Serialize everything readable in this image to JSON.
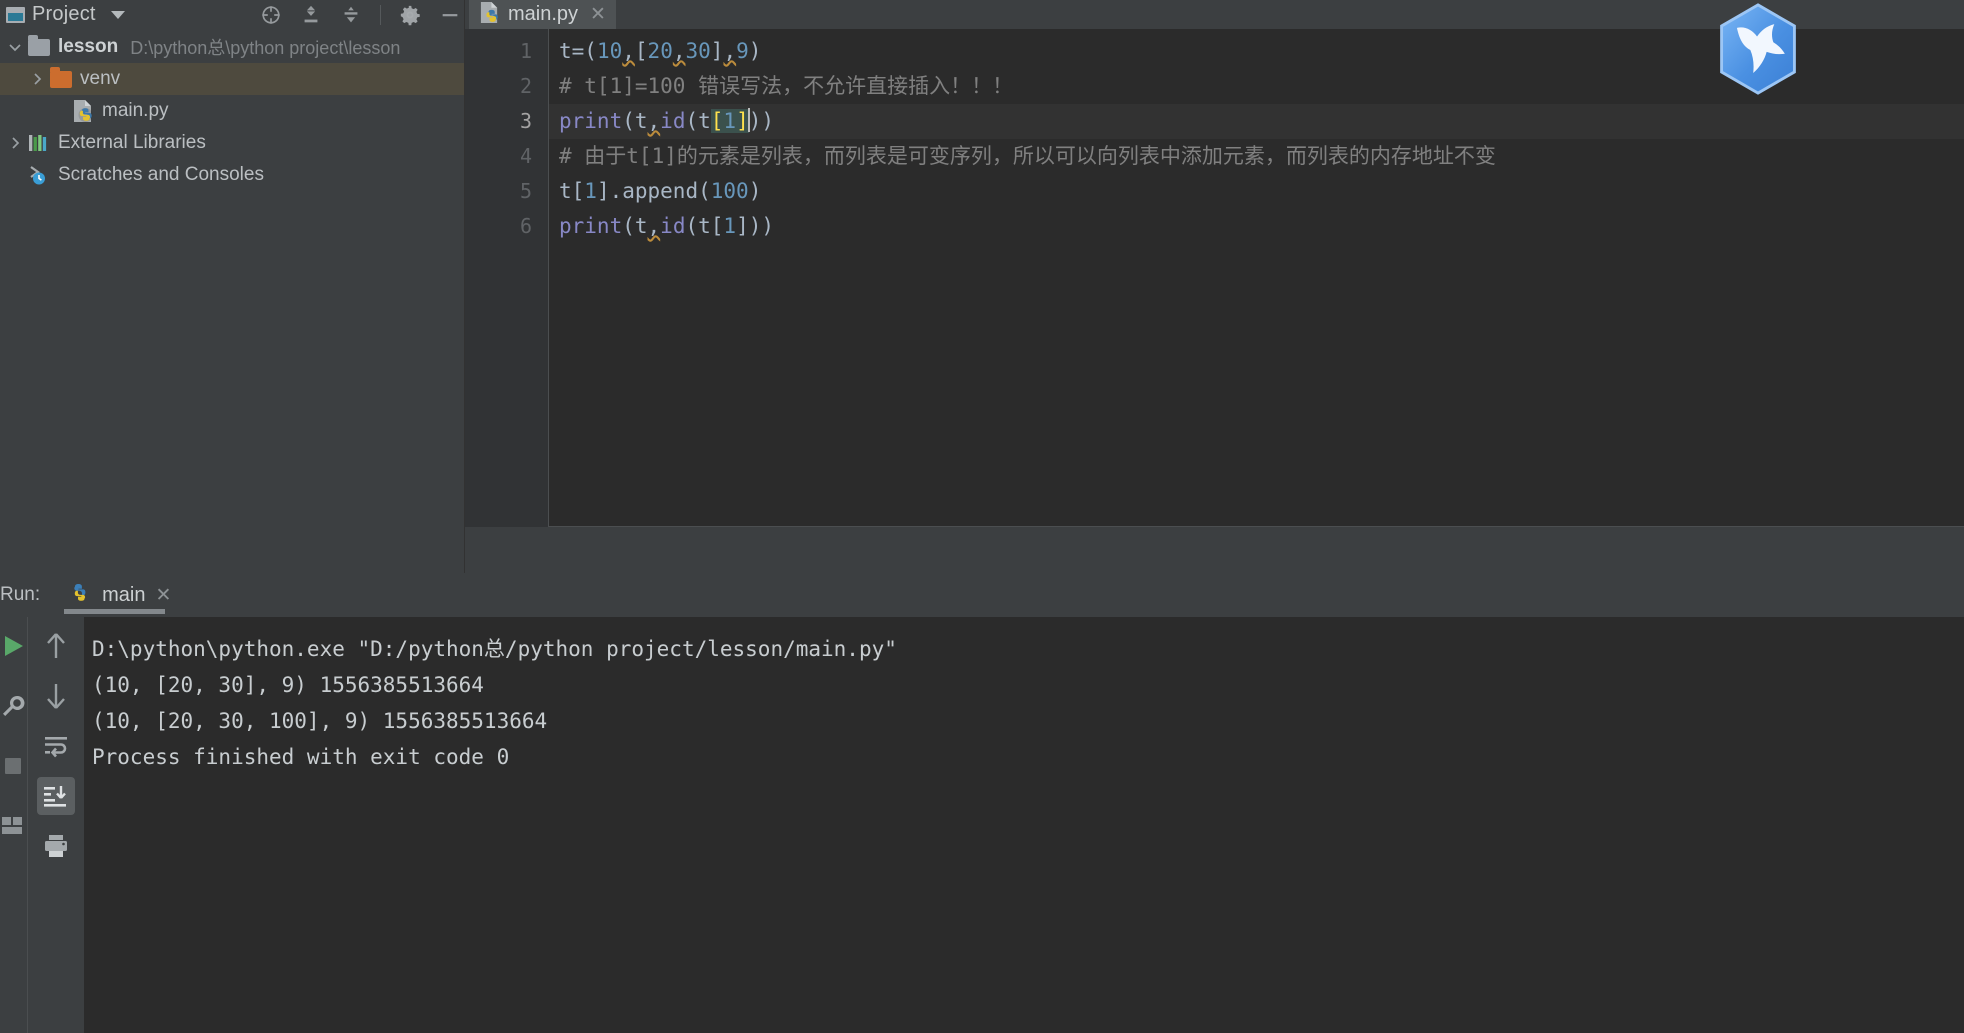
{
  "project_panel": {
    "title": "Project",
    "window_icon": "project-window-icon",
    "dropdown_icon": "chevron-down-icon",
    "toolbar": [
      {
        "name": "locate-icon",
        "tooltip": "Select Opened File"
      },
      {
        "name": "expand-all-icon",
        "tooltip": "Expand All"
      },
      {
        "name": "collapse-all-icon",
        "tooltip": "Collapse All"
      },
      {
        "name": "gear-icon",
        "tooltip": "Settings"
      },
      {
        "name": "minimize-icon",
        "tooltip": "Hide"
      }
    ],
    "tree": [
      {
        "label": "lesson",
        "path": "D:\\python总\\python project\\lesson",
        "icon": "folder-grey-icon",
        "arrow": "expanded",
        "bold": true,
        "selected": false,
        "indent": 0
      },
      {
        "label": "venv",
        "path": "",
        "icon": "folder-orange-icon",
        "arrow": "collapsed",
        "bold": false,
        "selected": true,
        "indent": 1
      },
      {
        "label": "main.py",
        "path": "",
        "icon": "python-file-icon",
        "arrow": "none",
        "bold": false,
        "selected": false,
        "indent": 2
      },
      {
        "label": "External Libraries",
        "path": "",
        "icon": "libraries-icon",
        "arrow": "collapsed",
        "bold": false,
        "selected": false,
        "indent": 0
      },
      {
        "label": "Scratches and Consoles",
        "path": "",
        "icon": "scratches-icon",
        "arrow": "none",
        "bold": false,
        "selected": false,
        "indent": 0
      }
    ]
  },
  "editor": {
    "tab": {
      "label": "main.py",
      "icon": "python-file-icon",
      "close_icon": "close-icon",
      "active": true
    },
    "gutter_numbers": [
      "1",
      "2",
      "3",
      "4",
      "5",
      "6"
    ],
    "current_line": 3,
    "lines": [
      {
        "n": "1",
        "text": "t=(10,[20,30],9)",
        "tokens": [
          {
            "t": "t=(",
            "c": "default"
          },
          {
            "t": "10",
            "c": "num"
          },
          {
            "t": ",",
            "c": "warn"
          },
          {
            "t": "[",
            "c": "default"
          },
          {
            "t": "20",
            "c": "num"
          },
          {
            "t": ",",
            "c": "warn"
          },
          {
            "t": "30",
            "c": "num"
          },
          {
            "t": "]",
            "c": "default"
          },
          {
            "t": ",",
            "c": "warn"
          },
          {
            "t": "9",
            "c": "num"
          },
          {
            "t": ")",
            "c": "default"
          }
        ]
      },
      {
        "n": "2",
        "text": "# t[1]=100 错误写法，不允许直接插入！！！",
        "tokens": [
          {
            "t": "# t[1]=100 错误写法，不允许直接插入！！！",
            "c": "comment"
          }
        ]
      },
      {
        "n": "3",
        "text": "print(t,id(t[1]))",
        "tokens": [
          {
            "t": "print",
            "c": "func"
          },
          {
            "t": "(t",
            "c": "default"
          },
          {
            "t": ",",
            "c": "warn"
          },
          {
            "t": "id",
            "c": "func"
          },
          {
            "t": "(t",
            "c": "default"
          },
          {
            "t": "[",
            "c": "brace"
          },
          {
            "t": "1",
            "c": "num-brace"
          },
          {
            "t": "]",
            "c": "brace-caret"
          },
          {
            "t": "))",
            "c": "default"
          }
        ]
      },
      {
        "n": "4",
        "text": "# 由于t[1]的元素是列表，而列表是可变序列，所以可以向列表中添加元素，而列表的内存地址不变",
        "tokens": [
          {
            "t": "# 由于t[1]的元素是列表，而列表是可变序列，所以可以向列表中添加元素，而列表的内存地址不变",
            "c": "comment"
          }
        ]
      },
      {
        "n": "5",
        "text": "t[1].append(100)",
        "tokens": [
          {
            "t": "t[",
            "c": "default"
          },
          {
            "t": "1",
            "c": "num"
          },
          {
            "t": "].append(",
            "c": "default"
          },
          {
            "t": "100",
            "c": "num"
          },
          {
            "t": ")",
            "c": "default"
          }
        ]
      },
      {
        "n": "6",
        "text": "print(t,id(t[1]))",
        "tokens": [
          {
            "t": "print",
            "c": "func"
          },
          {
            "t": "(t",
            "c": "default"
          },
          {
            "t": ",",
            "c": "warn"
          },
          {
            "t": "id",
            "c": "func"
          },
          {
            "t": "(t[",
            "c": "default"
          },
          {
            "t": "1",
            "c": "num"
          },
          {
            "t": "]))",
            "c": "default"
          }
        ]
      }
    ]
  },
  "run_panel": {
    "label": "Run:",
    "tab": {
      "label": "main",
      "icon": "python-file-icon",
      "close_icon": "close-icon"
    },
    "toolbar_left": [
      {
        "name": "rerun-icon",
        "active": false
      },
      {
        "name": "wrench-icon",
        "active": false
      },
      {
        "name": "stop-icon",
        "active": false
      },
      {
        "name": "layout-icon",
        "active": false
      }
    ],
    "toolbar_second": [
      {
        "name": "arrow-up-icon",
        "active": false
      },
      {
        "name": "arrow-down-icon",
        "active": false
      },
      {
        "name": "soft-wrap-icon",
        "active": false
      },
      {
        "name": "scroll-to-end-icon",
        "active": true
      },
      {
        "name": "print-icon",
        "active": false
      }
    ],
    "console_lines": [
      "D:\\python\\python.exe \"D:/python总/python project/lesson/main.py\"",
      "(10, [20, 30], 9) 1556385513664",
      "(10, [20, 30, 100], 9) 1556385513664",
      "",
      "Process finished with exit code 0"
    ]
  },
  "branding": {
    "logo_name": "pycharm-logo-icon"
  },
  "colors": {
    "panel_bg": "#3c3f41",
    "editor_bg": "#2b2b2b",
    "gutter_bg": "#313335",
    "selection": "#4e4a3e",
    "tab_active": "#4e5254",
    "tab_underline": "#4a88c7",
    "number_token": "#6897bb",
    "comment_token": "#808080",
    "function_token": "#8888c6",
    "text_token": "#a9b7c6",
    "logo_blue": "#4a90e2"
  }
}
